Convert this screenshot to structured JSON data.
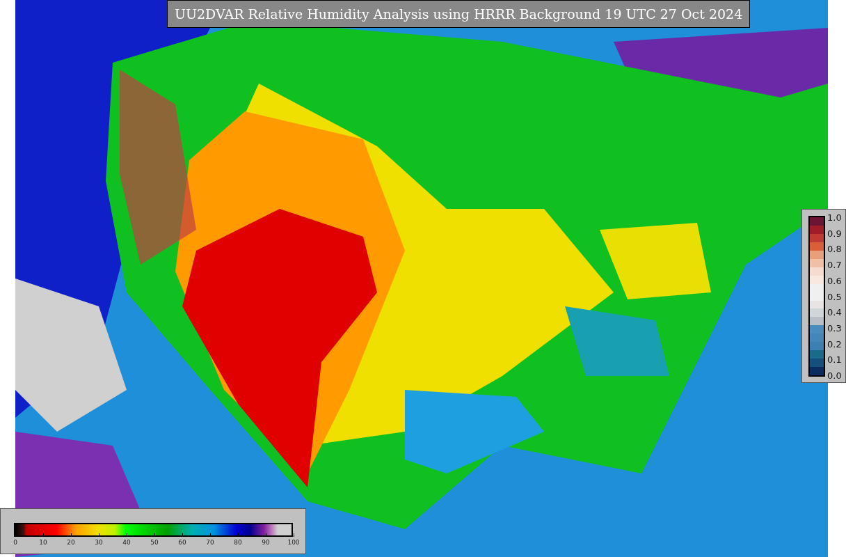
{
  "title": "UU2DVAR Relative Humidity Analysis using HRRR Background 19 UTC 27 Oct 2024",
  "humidity_scale": {
    "ticks": [
      "0",
      "10",
      "20",
      "30",
      "40",
      "50",
      "60",
      "70",
      "80",
      "90",
      "100"
    ]
  },
  "station_scale": {
    "ticks": [
      "1.0",
      "0.9",
      "0.8",
      "0.7",
      "0.6",
      "0.5",
      "0.4",
      "0.3",
      "0.2",
      "0.1",
      "0.0"
    ]
  }
}
